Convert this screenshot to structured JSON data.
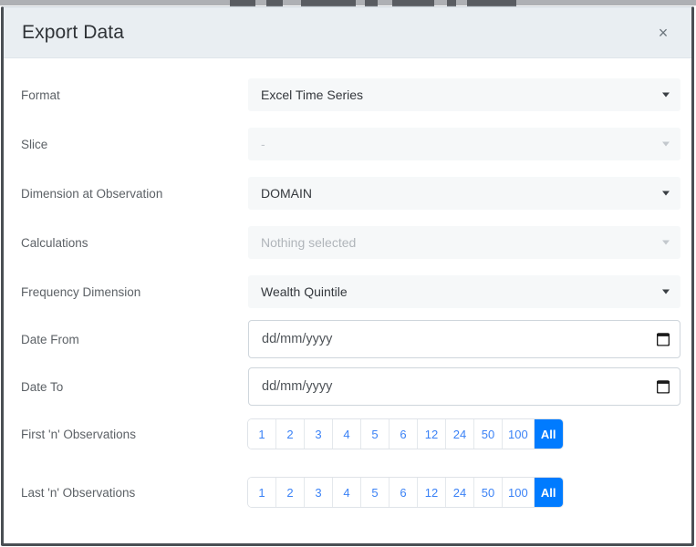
{
  "dialog": {
    "title": "Export Data",
    "close_label": "×",
    "close_icon": "close-icon"
  },
  "rows": [
    {
      "label": "Format",
      "type": "select",
      "value": "Excel Time Series",
      "disabled": false,
      "name": "format"
    },
    {
      "label": "Slice",
      "type": "select",
      "value": "-",
      "disabled": true,
      "name": "slice"
    },
    {
      "label": "Dimension at Observation",
      "type": "select",
      "value": "DOMAIN",
      "disabled": false,
      "name": "dimension-at-observation"
    },
    {
      "label": "Calculations",
      "type": "select",
      "value": "Nothing selected",
      "disabled": true,
      "name": "calculations"
    },
    {
      "label": "Frequency Dimension",
      "type": "select",
      "value": "Wealth Quintile",
      "disabled": false,
      "name": "frequency-dimension"
    },
    {
      "label": "Date From",
      "type": "date",
      "value": "",
      "placeholder": "dd/mm/yyyy",
      "name": "date-from"
    },
    {
      "label": "Date To",
      "type": "date",
      "value": "",
      "placeholder": "dd/mm/yyyy",
      "name": "date-to"
    },
    {
      "label": "First 'n' Observations",
      "type": "buttongroup",
      "name": "first-n-observations",
      "options": [
        "1",
        "2",
        "3",
        "4",
        "5",
        "6",
        "12",
        "24",
        "50",
        "100",
        "All"
      ],
      "selected": "All"
    },
    {
      "label": "Last 'n' Observations",
      "type": "buttongroup",
      "name": "last-n-observations",
      "options": [
        "1",
        "2",
        "3",
        "4",
        "5",
        "6",
        "12",
        "24",
        "50",
        "100",
        "All"
      ],
      "selected": "All"
    }
  ],
  "colors": {
    "accent": "#007bff",
    "link": "#3b82f6",
    "header_bg": "#e9eef2",
    "field_bg": "#f6f8f9",
    "label_text": "#5c6166",
    "value_text": "#34383d",
    "disabled_text": "#b0b5ba",
    "window_border": "#4a4f54"
  }
}
